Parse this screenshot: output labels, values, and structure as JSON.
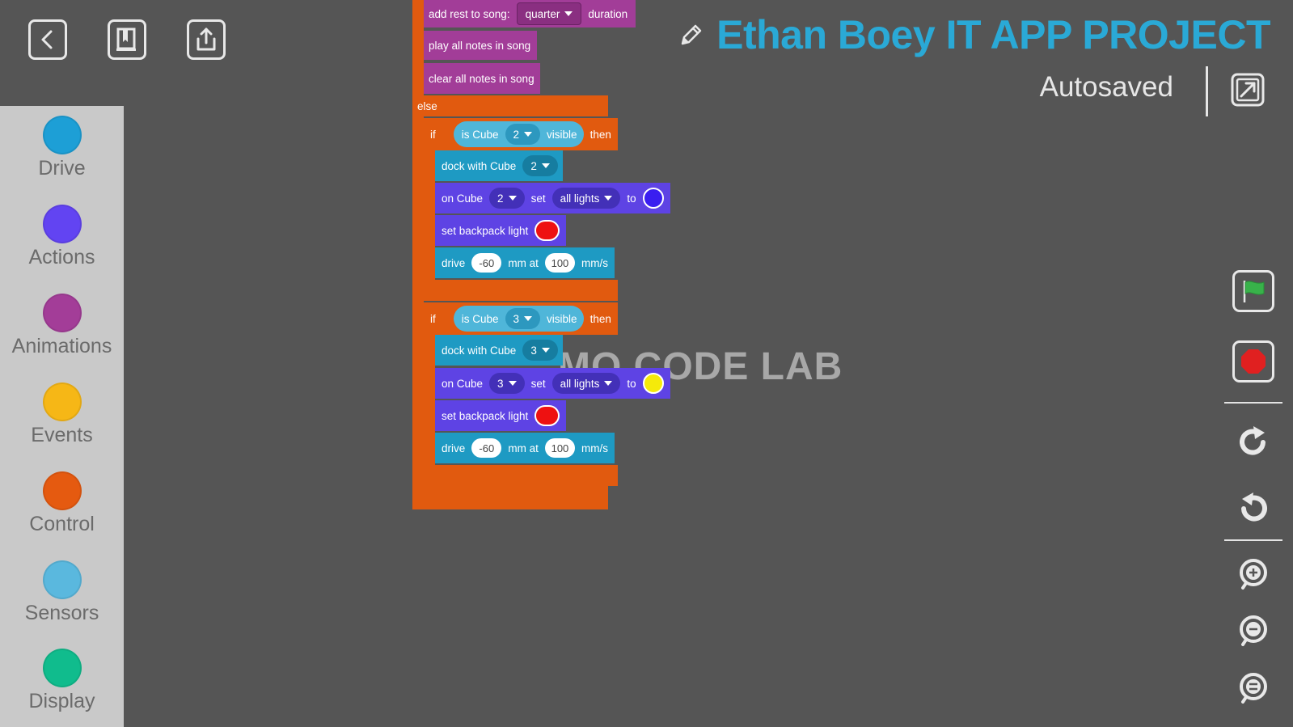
{
  "header": {
    "project_title": "Ethan Boey IT APP PROJECT",
    "autosave_status": "Autosaved",
    "accent_color": "#2aa9d6"
  },
  "toolbar": {
    "icons": [
      "back-icon",
      "docs-icon",
      "share-icon"
    ]
  },
  "sidebar": {
    "categories": [
      {
        "label": "Drive",
        "color": "#1d9fd6"
      },
      {
        "label": "Actions",
        "color": "#6244f2"
      },
      {
        "label": "Animations",
        "color": "#a33d98"
      },
      {
        "label": "Events",
        "color": "#f6b716"
      },
      {
        "label": "Control",
        "color": "#e55a10"
      },
      {
        "label": "Sensors",
        "color": "#5ab8de"
      },
      {
        "label": "Display",
        "color": "#10bc8d"
      }
    ]
  },
  "canvas": {
    "watermark": "MO CODE LAB",
    "blocks": {
      "add_rest": {
        "label": "add rest to song:",
        "dropdown": "quarter",
        "suffix": "duration"
      },
      "play_all": "play all notes in song",
      "clear_all": "clear all notes in song",
      "else_label": "else",
      "if1": {
        "if_label": "if",
        "condition": {
          "prefix": "is Cube",
          "cube": "2",
          "suffix": "visible"
        },
        "then_label": "then",
        "dock": {
          "label": "dock with Cube",
          "cube": "2"
        },
        "lights": {
          "prefix": "on Cube",
          "cube": "2",
          "set_label": "set",
          "target": "all lights",
          "to_label": "to",
          "color": "#3a1ef0"
        },
        "backpack": {
          "label": "set backpack light",
          "color": "#ee1111"
        },
        "drive": {
          "label": "drive",
          "distance": "-60",
          "mid": "mm at",
          "speed": "100",
          "unit": "mm/s"
        }
      },
      "if2": {
        "if_label": "if",
        "condition": {
          "prefix": "is Cube",
          "cube": "3",
          "suffix": "visible"
        },
        "then_label": "then",
        "dock": {
          "label": "dock with Cube",
          "cube": "3"
        },
        "lights": {
          "prefix": "on Cube",
          "cube": "3",
          "set_label": "set",
          "target": "all lights",
          "to_label": "to",
          "color": "#f5ea0a"
        },
        "backpack": {
          "label": "set backpack light",
          "color": "#ee1111"
        },
        "drive": {
          "label": "drive",
          "distance": "-60",
          "mid": "mm at",
          "speed": "100",
          "unit": "mm/s"
        }
      }
    }
  },
  "right_controls": {
    "icons": [
      "green-flag-icon",
      "stop-icon",
      "redo-icon",
      "undo-icon",
      "zoom-in-icon",
      "zoom-out-icon",
      "zoom-reset-icon"
    ]
  }
}
